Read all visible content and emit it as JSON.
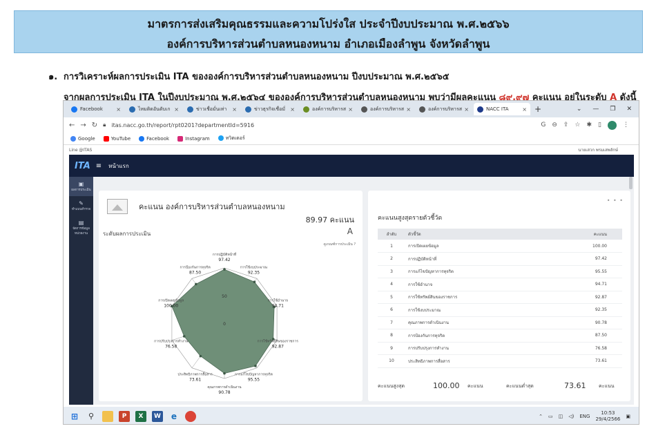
{
  "banner": {
    "line1": "มาตรการส่งเสริมคุณธรรมและความโปร่งใส ประจำปีงบประมาณ พ.ศ.๒๕๖๖",
    "line2": "องค์การบริหารส่วนตำบลหนองหนาม  อำเภอเมืองลำพูน  จังหวัดลำพูน"
  },
  "para": {
    "num": "๑.",
    "line1": "การวิเคราะห์ผลการประเมิน ITA ขององค์การบริหารส่วนตำบลหนองหนาม ปีงบประมาณ พ.ศ.๒๕๖๕",
    "line2_a": "จากผลการประเมิน ITA ในปีงบประมาณ พ.ศ.๒๕๖๔ ขององค์การบริหารส่วนตำบลหนองหนาม พบว่ามีผลคะแนน ",
    "line2_score": "๘๙.๙๗",
    "line2_b": " คะแนน อยู่ในระดับ ",
    "line2_level": "A",
    "line2_c": " ดังนี้"
  },
  "browser": {
    "tabs": [
      {
        "label": "Facebook",
        "color": "#1877f2"
      },
      {
        "label": "ไหมติดอันดับเก",
        "color": "#2b6cb0"
      },
      {
        "label": "ข่าวเชื่อมั่นเท่า",
        "color": "#2b6cb0"
      },
      {
        "label": "ข่าวธุรกิจเชื่อมั่",
        "color": "#2b6cb0"
      },
      {
        "label": "องค์การบริหารส",
        "color": "#6b8e23"
      },
      {
        "label": "องค์การบริหารส",
        "color": "#555555"
      },
      {
        "label": "องค์การบริหารส",
        "color": "#555555"
      },
      {
        "label": "NACC ITA",
        "color": "#1e3a8a",
        "active": true
      }
    ],
    "url": "itas.nacc.go.th/report/rpt0201?departmentId=5916",
    "bookmarks": [
      "Google",
      "YouTube",
      "Facebook",
      "Instagram",
      "ทวิตเตอร์"
    ],
    "strip_left": "Line @ITAS",
    "strip_user": "นายเสวก พรมเสพลักษ์"
  },
  "ita": {
    "logo": "ITA",
    "home": "หน้าแรก",
    "side": [
      "ผลการประเมิน",
      "ทำแบบสำรวจ",
      "จัดการข้อมูลหน่วยงาน"
    ],
    "card1": {
      "title": "คะแนน องค์การบริหารส่วนตำบลหนองหนาม",
      "score": "89.97 คะแนน",
      "level_label": "ระดับผลการประเมิน",
      "level": "A",
      "howto": "ดูเกณฑ์การประเมิน"
    },
    "card2": {
      "title": "คะแนนสูงสุดรายตัวชี้วัด",
      "headers": [
        "ลำดับ",
        "ตัวชี้วัด",
        "คะแนน"
      ],
      "rows": [
        {
          "no": "1",
          "name": "การเปิดเผยข้อมูล",
          "score": "100.00"
        },
        {
          "no": "2",
          "name": "การปฏิบัติหน้าที่",
          "score": "97.42"
        },
        {
          "no": "3",
          "name": "การแก้ไขปัญหาการทุจริต",
          "score": "95.55"
        },
        {
          "no": "4",
          "name": "การใช้อำนาจ",
          "score": "94.71"
        },
        {
          "no": "5",
          "name": "การใช้ทรัพย์สินของราชการ",
          "score": "92.87"
        },
        {
          "no": "6",
          "name": "การใช้งบประมาณ",
          "score": "92.35"
        },
        {
          "no": "7",
          "name": "คุณภาพการดำเนินงาน",
          "score": "90.78"
        },
        {
          "no": "8",
          "name": "การป้องกันการทุจริต",
          "score": "87.50"
        },
        {
          "no": "9",
          "name": "การปรับปรุงการทำงาน",
          "score": "76.58"
        },
        {
          "no": "10",
          "name": "ประสิทธิภาพการสื่อสาร",
          "score": "73.61"
        }
      ],
      "max_label": "คะแนนสูงสุด",
      "max_value": "100.00",
      "min_label": "คะแนนต่ำสุด",
      "min_value": "73.61",
      "unit": "คะแนน"
    }
  },
  "taskbar": {
    "lang": "ENG",
    "time": "10:53",
    "date": "29/4/2566"
  },
  "chart_data": {
    "type": "radar",
    "categories": [
      "การปฏิบัติหน้าที่",
      "การใช้งบประมาณ",
      "การใช้อำนาจ",
      "การใช้ทรัพย์สินของราชการ",
      "การแก้ไขปัญหาการทุจริต",
      "คุณภาพการดำเนินงาน",
      "ประสิทธิภาพการสื่อสาร",
      "การปรับปรุงการทำงาน",
      "การเปิดเผยข้อมูล",
      "การป้องกันการทุจริต"
    ],
    "values": [
      97.42,
      92.35,
      94.71,
      92.87,
      95.55,
      90.78,
      73.61,
      76.58,
      100.0,
      87.5
    ],
    "value_labels": [
      "97.42",
      "92.35",
      "94.71",
      "92.87",
      "95.55",
      "90.78",
      "73.61",
      "76.58",
      "100.00",
      "87.50"
    ],
    "ticks": [
      "0",
      "50"
    ],
    "range": [
      0,
      100
    ],
    "fill": "#6f8f78"
  }
}
